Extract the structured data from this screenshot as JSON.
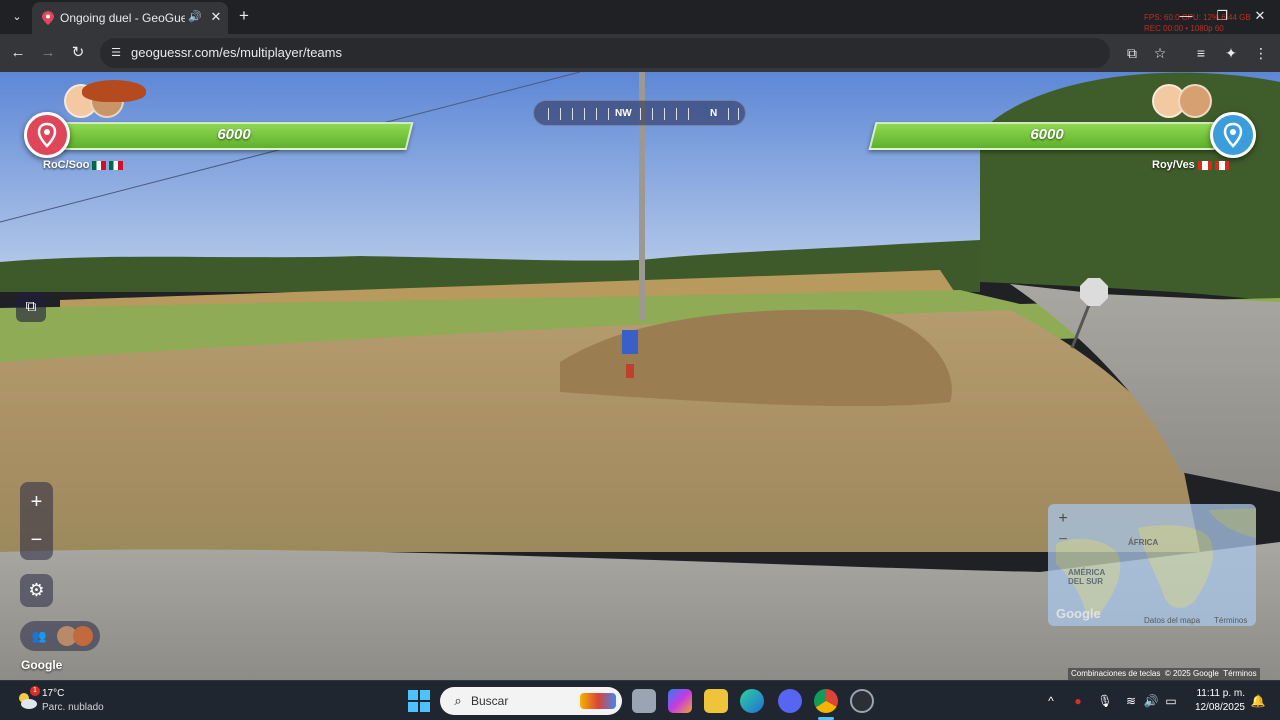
{
  "browser": {
    "tab": {
      "title": "Ongoing duel - GeoGuessr",
      "favicon": "location-pin-icon",
      "audio": "speaker-icon",
      "close": "✕"
    },
    "new_tab": "+",
    "url": "geoguessr.com/es/multiplayer/teams",
    "recording_overlay": [
      "FPS: 60.0     CPU: 12% 6.44 GB",
      "REC 00:00     • 1080p 60"
    ],
    "icons": [
      "back-icon",
      "forward-icon",
      "reload-icon",
      "install-icon",
      "bookmark-star-icon",
      "reading-list-icon",
      "extensions-icon",
      "menu-icon"
    ],
    "colors": {
      "chrome_dark": "#202124",
      "chrome_tab": "#35363a",
      "omnibox": "#282a2d"
    }
  },
  "duel": {
    "left_team": {
      "health": "6000",
      "name": "RoC/Soo",
      "flags": [
        "mexico-flag",
        "mexico-flag"
      ],
      "pin_color": "#e0465a"
    },
    "right_team": {
      "health": "6000",
      "name": "Roy/Ves",
      "flags": [
        "canada-flag",
        "canada-flag"
      ],
      "pin_color": "#3b9ddb"
    },
    "health_bar_color": "#7ac943",
    "compass": {
      "labels": [
        "NW",
        "N"
      ]
    },
    "controls": {
      "zoom_in": "+",
      "zoom_out": "−",
      "settings": "gear-icon",
      "map_toggle": "map-toggle-icon",
      "team_chat": "team-chat-icon"
    },
    "google_watermark": "Google"
  },
  "minimap": {
    "labels": {
      "africa": "ÁFRICA",
      "south_america": "AMÉRICA DEL SUR"
    },
    "google": "Google",
    "attribution": {
      "map_data": "Datos del mapa",
      "terms": "Términos"
    },
    "zoom_in": "+",
    "zoom_out": "−"
  },
  "streetview_attribution": {
    "shortcuts": "Combinaciones de teclas",
    "copyright": "© 2025 Google",
    "terms": "Términos"
  },
  "taskbar": {
    "weather": {
      "temp": "17°C",
      "desc": "Parc. nublado",
      "badge": "1"
    },
    "search_placeholder": "Buscar",
    "clock": {
      "time": "11:11 p. m.",
      "date": "12/08/2025"
    },
    "apps": [
      "windows-start-icon",
      "search-icon",
      "copilot-icon",
      "task-view-icon",
      "file-explorer-icon",
      "edge-icon",
      "discord-icon",
      "chrome-icon",
      "obs-icon"
    ],
    "tray": [
      "chevron-up-icon",
      "antivirus-icon",
      "microphone-icon",
      "wifi-icon",
      "volume-icon",
      "battery-icon",
      "notification-bell-icon"
    ]
  }
}
